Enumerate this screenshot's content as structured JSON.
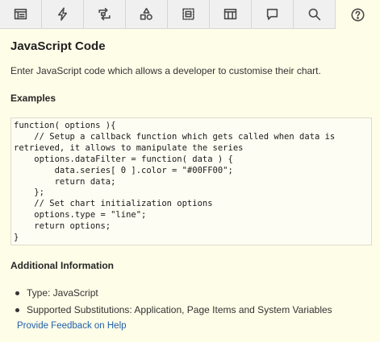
{
  "toolbar": {
    "tools": [
      {
        "name": "properties-icon",
        "active": false
      },
      {
        "name": "dynamic-actions-icon",
        "active": false
      },
      {
        "name": "processing-icon",
        "active": false
      },
      {
        "name": "shared-components-icon",
        "active": false
      },
      {
        "name": "region-icon",
        "active": false
      },
      {
        "name": "layout-icon",
        "active": false
      },
      {
        "name": "comments-icon",
        "active": false
      },
      {
        "name": "search-icon",
        "active": false
      },
      {
        "name": "help-icon",
        "active": true
      }
    ]
  },
  "help": {
    "title": "JavaScript Code",
    "description": "Enter JavaScript code which allows a developer to customise their chart.",
    "examples_heading": "Examples",
    "code": "function( options ){\n    // Setup a callback function which gets called when data is\nretrieved, it allows to manipulate the series\n    options.dataFilter = function( data ) {\n        data.series[ 0 ].color = \"#00FF00\";\n        return data;\n    };\n    // Set chart initialization options\n    options.type = \"line\";\n    return options;\n}",
    "additional_heading": "Additional Information",
    "info_items": [
      "Type: JavaScript",
      "Supported Substitutions: Application, Page Items and System Variables"
    ],
    "feedback_link": "Provide Feedback on Help"
  }
}
